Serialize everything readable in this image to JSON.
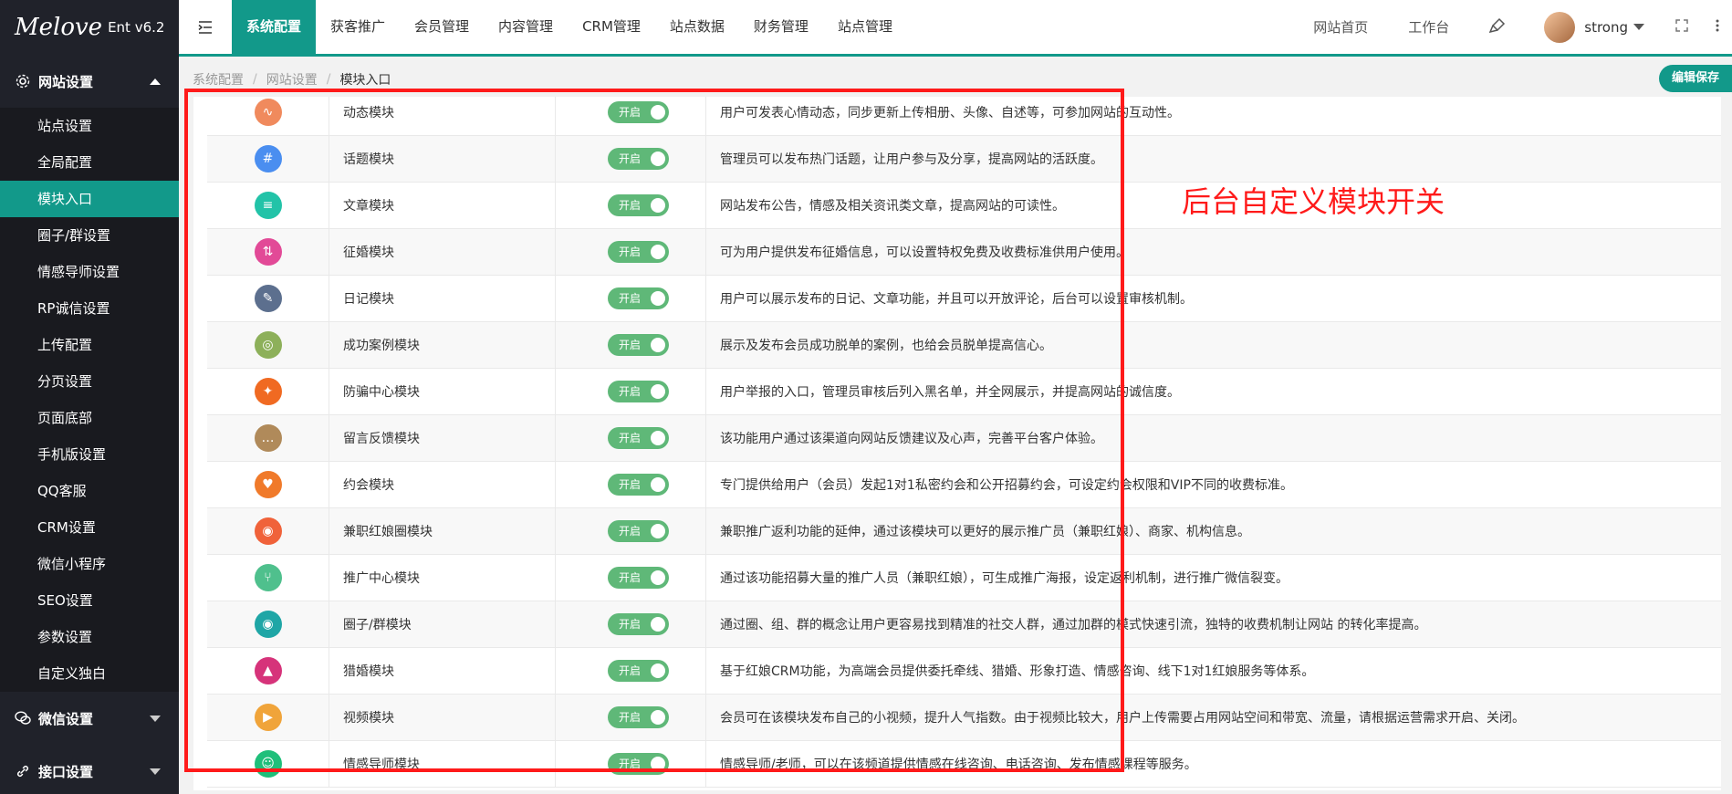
{
  "brand": {
    "logo": "Melove",
    "version": "Ent v6.2"
  },
  "sidebar": {
    "groups": [
      {
        "label": "网站设置",
        "icon": "gear-icon",
        "expanded": true
      },
      {
        "label": "微信设置",
        "icon": "wechat-icon",
        "expanded": false
      },
      {
        "label": "接口设置",
        "icon": "link-icon",
        "expanded": false
      }
    ],
    "items": [
      "站点设置",
      "全局配置",
      "模块入口",
      "圈子/群设置",
      "情感导师设置",
      "RP诚信设置",
      "上传配置",
      "分页设置",
      "页面底部",
      "手机版设置",
      "QQ客服",
      "CRM设置",
      "微信小程序",
      "SEO设置",
      "参数设置",
      "自定义独白"
    ],
    "active_item": "模块入口"
  },
  "topnav": {
    "tabs": [
      "系统配置",
      "获客推广",
      "会员管理",
      "内容管理",
      "CRM管理",
      "站点数据",
      "财务管理",
      "站点管理"
    ],
    "active_tab": "系统配置",
    "right_links": [
      "网站首页",
      "工作台"
    ],
    "username": "strong"
  },
  "breadcrumb": {
    "items": [
      "系统配置",
      "网站设置",
      "模块入口"
    ]
  },
  "save_button": "编辑保存",
  "switch_label": "开启",
  "annotation": "后台自定义模块开关",
  "modules": [
    {
      "name": "动态模块",
      "desc": "用户可发表心情动态，同步更新上传相册、头像、自述等，可参加网站的互动性。",
      "icon": "activity-icon",
      "color": "#f08a5d"
    },
    {
      "name": "话题模块",
      "desc": "管理员可以发布热门话题，让用户参与及分享，提高网站的活跃度。",
      "icon": "hashtag-icon",
      "color": "#4a8ef0"
    },
    {
      "name": "文章模块",
      "desc": "网站发布公告，情感及相关资讯类文章，提高网站的可读性。",
      "icon": "document-icon",
      "color": "#22c3a8"
    },
    {
      "name": "征婚模块",
      "desc": "可为用户提供发布征婚信息，可以设置特权免费及收费标准供用户使用。",
      "icon": "exchange-icon",
      "color": "#e24a97"
    },
    {
      "name": "日记模块",
      "desc": "用户可以展示发布的日记、文章功能，并且可以开放评论，后台可以设置审核机制。",
      "icon": "diary-icon",
      "color": "#5c6f8e"
    },
    {
      "name": "成功案例模块",
      "desc": "展示及发布会员成功脱单的案例，也给会员脱单提高信心。",
      "icon": "rings-icon",
      "color": "#8db05a"
    },
    {
      "name": "防骗中心模块",
      "desc": "用户举报的入口，管理员审核后列入黑名单，并全网展示，并提高网站的诚信度。",
      "icon": "shield-icon",
      "color": "#f06a22"
    },
    {
      "name": "留言反馈模块",
      "desc": "该功能用户通过该渠道向网站反馈建议及心声，完善平台客户体验。",
      "icon": "chat-icon",
      "color": "#b08a5a"
    },
    {
      "name": "约会模块",
      "desc": "专门提供给用户（会员）发起1对1私密约会和公开招募约会，可设定约会权限和VIP不同的收费标准。",
      "icon": "heart-icon",
      "color": "#f07a2a"
    },
    {
      "name": "兼职红娘圈模块",
      "desc": "兼职推广返利功能的延伸，通过该模块可以更好的展示推广员（兼职红娘）、商家、机构信息。",
      "icon": "weibo-icon",
      "color": "#f0623a"
    },
    {
      "name": "推广中心模块",
      "desc": "通过该功能招募大量的推广人员（兼职红娘），可生成推广海报，设定返利机制，进行推广微信裂变。",
      "icon": "share-icon",
      "color": "#4fc08d"
    },
    {
      "name": "圈子/群模块",
      "desc": "通过圈、组、群的概念让用户更容易找到精准的社交人群，通过加群的模式快速引流，独特的收费机制让网站 的转化率提高。",
      "icon": "circle-group-icon",
      "color": "#1fa6a6"
    },
    {
      "name": "猎婚模块",
      "desc": "基于红娘CRM功能，为高端会员提供委托牵线、猎婚、形象打造、情感咨询、线下1对1红娘服务等体系。",
      "icon": "fire-icon",
      "color": "#d6337a"
    },
    {
      "name": "视频模块",
      "desc": "会员可在该模块发布自己的小视频，提升人气指数。由于视频比较大，用户上传需要占用网站空间和带宽、流量，请根据运营需求开启、关闭。",
      "icon": "play-icon",
      "color": "#f0a43a"
    },
    {
      "name": "情感导师模块",
      "desc": "情感导师/老师，可以在该频道提供情感在线咨询、电话咨询、发布情感课程等服务。",
      "icon": "mentor-icon",
      "color": "#1fbf7a"
    }
  ]
}
